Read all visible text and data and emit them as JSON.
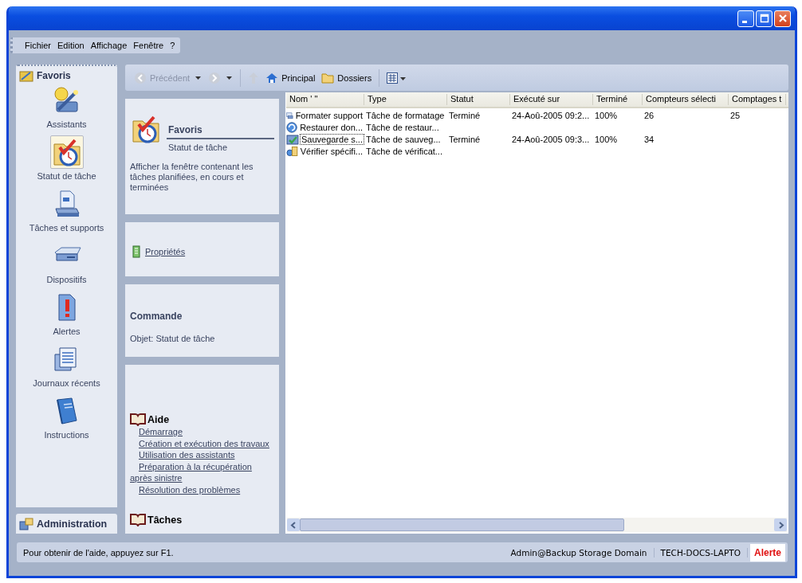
{
  "menu": [
    {
      "label": "Fichier"
    },
    {
      "label": "Edition"
    },
    {
      "label": "Affichage"
    },
    {
      "label": "Fenêtre"
    },
    {
      "label": "?"
    }
  ],
  "sidebar": {
    "title": "Favoris",
    "items": [
      {
        "label": "Assistants",
        "selected": false
      },
      {
        "label": "Statut de tâche",
        "selected": true
      },
      {
        "label": "Tâches et supports",
        "selected": false
      },
      {
        "label": "Dispositifs",
        "selected": false
      },
      {
        "label": "Alertes",
        "selected": false
      },
      {
        "label": "Journaux récents",
        "selected": false
      },
      {
        "label": "Instructions",
        "selected": false
      }
    ],
    "admin": "Administration"
  },
  "toolbar": {
    "back": {
      "label": "Précédent",
      "disabled": true
    },
    "forward": {
      "disabled": true
    },
    "up": {
      "disabled": true
    },
    "home": "Principal",
    "folders": "Dossiers"
  },
  "task_pane": {
    "header": {
      "title": "Favoris",
      "subtitle": "Statut de tâche",
      "description": "Afficher la fenêtre contenant les tâches planifiées, en cours et terminées"
    },
    "properties": "Propriétés",
    "command": {
      "title": "Commande",
      "object": "Objet: Statut de tâche"
    },
    "help": {
      "title": "Aide",
      "links": [
        "Démarrage",
        "Création et exécution des travaux",
        "Utilisation des assistants",
        "Préparation à la récupération après sinistre",
        "Résolution des problèmes"
      ]
    },
    "tasks": {
      "title": "Tâches"
    }
  },
  "list": {
    "columns": [
      "Nom ' \"",
      "Type",
      "Statut",
      "Exécuté sur",
      "Terminé",
      "Compteurs sélecti",
      "Comptages t"
    ],
    "rows": [
      {
        "focused": false,
        "cells": [
          "Formater support",
          "Tâche de formatage",
          "Terminé",
          "24-Aoû-2005 09:2...",
          "100%",
          "26",
          "25"
        ]
      },
      {
        "focused": false,
        "cells": [
          "Restaurer don...",
          "Tâche de restaur...",
          "",
          "",
          "",
          "",
          ""
        ]
      },
      {
        "focused": true,
        "cells": [
          "Sauvegarde s...",
          "Tâche de sauveg...",
          "Terminé",
          "24-Aoû-2005 09:3...",
          "100%",
          "34",
          ""
        ]
      },
      {
        "focused": false,
        "cells": [
          "Vérifier spécifi...",
          "Tâche de vérificat...",
          "",
          "",
          "",
          "",
          ""
        ]
      }
    ]
  },
  "status_bar": {
    "hint": "Pour obtenir de l'aide, appuyez sur F1.",
    "user": "Admin@Backup Storage Domain",
    "computer": "TECH-DOCS-LAPTO",
    "alert": "Alerte"
  }
}
